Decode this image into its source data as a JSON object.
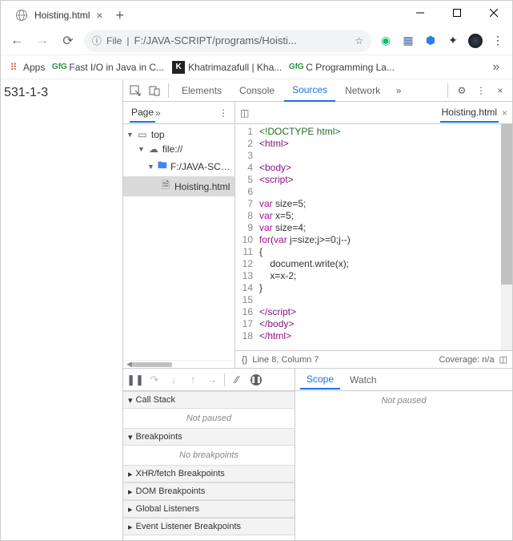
{
  "window": {
    "title": "Hoisting.html"
  },
  "address": {
    "prefix": "File",
    "url": "F:/JAVA-SCRIPT/programs/Hoisti..."
  },
  "bookmarks": {
    "apps": "Apps",
    "items": [
      "Fast I/O in Java in C...",
      "Khatrimazafull | Kha...",
      "C Programming La..."
    ]
  },
  "page_output": "531-1-3",
  "devtools": {
    "tabs": [
      "Elements",
      "Console",
      "Sources",
      "Network"
    ],
    "active_tab": "Sources",
    "page_tab": "Page",
    "file_tab": "Hoisting.html",
    "tree": {
      "top": "top",
      "file_scheme": "file://",
      "folder": "F:/JAVA-SCRIPT/pro",
      "file": "Hoisting.html"
    },
    "code_lines": [
      "<!DOCTYPE html>",
      "<html>",
      "",
      "<body>",
      "<script>",
      "",
      "var size=5;",
      "var x=5;",
      "var size=4;",
      "for(var j=size;j>=0;j--)",
      "{",
      "    document.write(x);",
      "    x=x-2;",
      "}",
      "",
      "</script>",
      "</body>",
      "</html>"
    ],
    "status": {
      "cursor": "Line 8, Column 7",
      "coverage": "Coverage: n/a"
    },
    "debugger": {
      "panes": [
        "Call Stack",
        "Breakpoints",
        "XHR/fetch Breakpoints",
        "DOM Breakpoints",
        "Global Listeners",
        "Event Listener Breakpoints"
      ],
      "not_paused": "Not paused",
      "no_breakpoints": "No breakpoints",
      "right_tabs": [
        "Scope",
        "Watch"
      ]
    }
  }
}
